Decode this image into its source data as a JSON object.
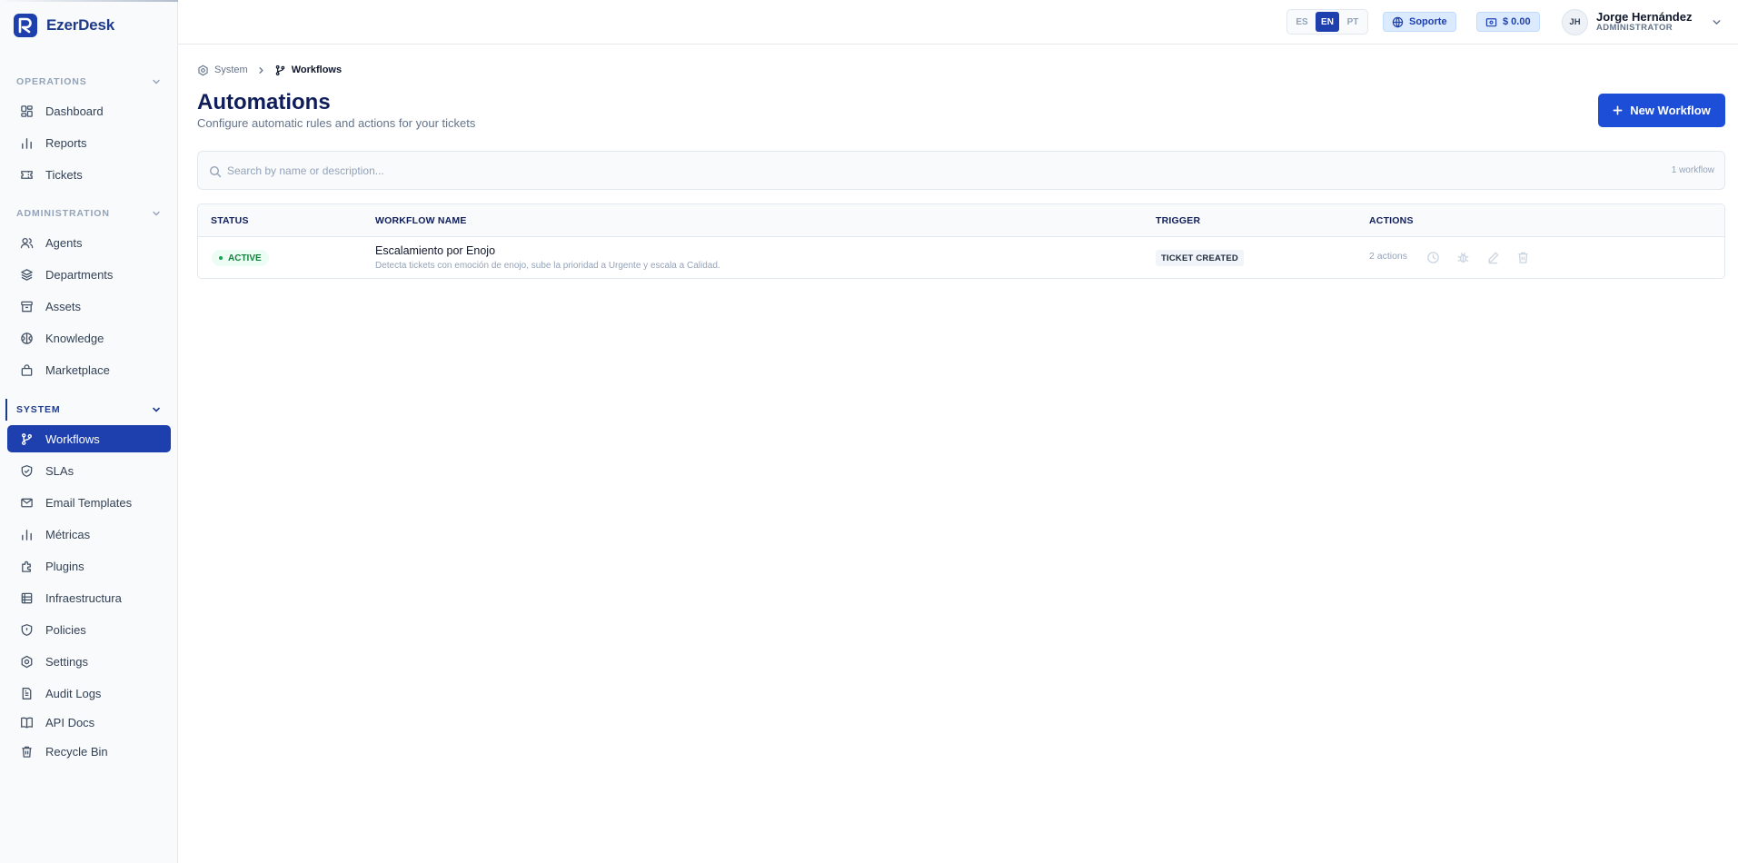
{
  "brand": {
    "name": "EzerDesk"
  },
  "sidebar": {
    "sections": [
      {
        "title": "OPERATIONS",
        "items": [
          {
            "label": "Dashboard",
            "icon": "dashboard-icon"
          },
          {
            "label": "Reports",
            "icon": "bar-chart-icon"
          },
          {
            "label": "Tickets",
            "icon": "ticket-icon"
          }
        ]
      },
      {
        "title": "ADMINISTRATION",
        "items": [
          {
            "label": "Agents",
            "icon": "users-icon"
          },
          {
            "label": "Departments",
            "icon": "layers-icon"
          },
          {
            "label": "Assets",
            "icon": "archive-icon"
          },
          {
            "label": "Knowledge",
            "icon": "brain-icon"
          },
          {
            "label": "Marketplace",
            "icon": "shopping-bag-icon"
          }
        ]
      },
      {
        "title": "SYSTEM",
        "items": [
          {
            "label": "Workflows",
            "icon": "git-branch-icon",
            "active": true
          },
          {
            "label": "SLAs",
            "icon": "shield-check-icon"
          },
          {
            "label": "Email Templates",
            "icon": "mail-icon"
          },
          {
            "label": "Métricas",
            "icon": "bar-chart-icon"
          },
          {
            "label": "Plugins",
            "icon": "plug-icon"
          },
          {
            "label": "Infraestructura",
            "icon": "server-icon"
          },
          {
            "label": "Policies",
            "icon": "shield-icon"
          },
          {
            "label": "Settings",
            "icon": "gear-icon"
          },
          {
            "label": "Audit Logs",
            "icon": "file-text-icon"
          },
          {
            "label": "API Docs",
            "icon": "book-icon"
          },
          {
            "label": "Recycle Bin",
            "icon": "trash-icon"
          }
        ]
      }
    ]
  },
  "topbar": {
    "languages": [
      "ES",
      "EN",
      "PT"
    ],
    "active_language": "EN",
    "support_label": "Soporte",
    "balance_label": "$ 0.00",
    "user": {
      "initials": "JH",
      "name": "Jorge Hernández",
      "role": "ADMINISTRATOR"
    }
  },
  "breadcrumb": {
    "parent": "System",
    "current": "Workflows"
  },
  "page": {
    "title": "Automations",
    "subtitle": "Configure automatic rules and actions for your tickets",
    "new_button": "New Workflow"
  },
  "search": {
    "placeholder": "Search by name or description...",
    "value": "",
    "count": "1 workflow"
  },
  "table": {
    "columns": [
      "STATUS",
      "WORKFLOW NAME",
      "TRIGGER",
      "ACTIONS"
    ],
    "rows": [
      {
        "status": "ACTIVE",
        "name": "Escalamiento por Enojo",
        "description": "Detecta tickets con emoción de enojo, sube la prioridad a Urgente y escala a Calidad.",
        "trigger": "TICKET CREATED",
        "actions": "2 actions"
      }
    ]
  },
  "colors": {
    "primary": "#1d4ed8",
    "nav_active": "#1e40af",
    "heading": "#0f1e5a",
    "success": "#15803d"
  }
}
